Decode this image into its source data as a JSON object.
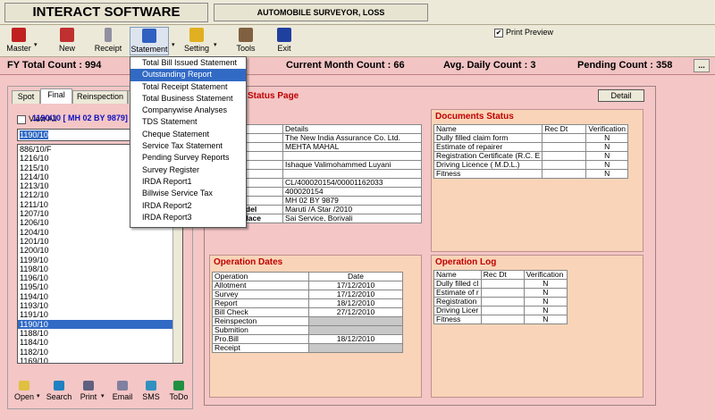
{
  "header": {
    "title": "INTERACT SOFTWARE",
    "subtitle": "AUTOMOBILE SURVEYOR, LOSS ASSESSOR_VALUERS"
  },
  "toolbar": {
    "master": "Master",
    "new": "New",
    "receipt": "Receipt",
    "statement": "Statement",
    "setting": "Setting",
    "tools": "Tools",
    "exit": "Exit",
    "print_preview": "Print Preview",
    "print_preview_checked": "✔"
  },
  "counts": {
    "fy_total": "FY Total Count : 994",
    "current_month": "Current Month Count : 66",
    "avg_daily": "Avg. Daily Count : 3",
    "pending": "Pending Count : 358",
    "more": "..."
  },
  "left": {
    "tabs": [
      "Spot",
      "Final",
      "Reinspection",
      "C"
    ],
    "view_all": "View All",
    "search_value": "1190/10",
    "ids": [
      "886/10/F",
      "1216/10",
      "1215/10",
      "1214/10",
      "1213/10",
      "1212/10",
      "1211/10",
      "1207/10",
      "1206/10",
      "1204/10",
      "1201/10",
      "1200/10",
      "1199/10",
      "1198/10",
      "1196/10",
      "1195/10",
      "1194/10",
      "1193/10",
      "1191/10",
      "1190/10",
      "1188/10",
      "1184/10",
      "1182/10",
      "1169/10"
    ],
    "selected_id": "1190/10"
  },
  "bottom": {
    "open": "Open",
    "search": "Search",
    "print": "Print",
    "email": "Email",
    "sms": "SMS",
    "todo": "ToDo"
  },
  "menu": {
    "items": [
      "Total Bill Issued Statement",
      "Outstanding Report",
      "Total Receipt Statement",
      "Total Business Statement",
      "Companywise Analyses",
      "TDS Statement",
      "Cheque Statement",
      "Service Tax Statement",
      "Pending Survey Reports",
      "Survey Register",
      "IRDA Report1",
      "Billwise Service Tax",
      "IRDA Report2",
      "IRDA Report3"
    ],
    "highlighted": "Outstanding Report"
  },
  "main": {
    "status_title": "Status Page",
    "detail_button": "Detail",
    "vehicle_id": "1190/10   [ MH 02 BY 9879]",
    "details_header": [
      "",
      "Details"
    ],
    "details": [
      {
        "label": "",
        "value": "The New India Assurance Co. Ltd."
      },
      {
        "label": "nch",
        "value": "MEHTA MAHAL"
      },
      {
        "label": "o.",
        "value": ""
      },
      {
        "label": "",
        "value": "Ishaque Valimohammed Luyani"
      },
      {
        "label": "o.",
        "value": ""
      },
      {
        "label": "o.",
        "value": "CL/400020154/00001162033"
      },
      {
        "label": "o.",
        "value": "400020154"
      },
      {
        "label": "o.",
        "value": "MH 02 BY 9879"
      },
      {
        "label": "Make/Model",
        "value": "Maruti /A Star /2010"
      },
      {
        "label": "Survey Place",
        "value": "Sai Service, Borivali"
      }
    ],
    "documents_title": "Documents Status",
    "documents_header": [
      "Name",
      "Rec Dt",
      "Verification"
    ],
    "documents": [
      {
        "name": "Dully filled claim form",
        "rec": "",
        "ver": "N"
      },
      {
        "name": "Estimate of repairer",
        "rec": "",
        "ver": "N"
      },
      {
        "name": "Registration Certificate (R.C. E",
        "rec": "",
        "ver": "N"
      },
      {
        "name": "Driving Licence ( M.D.L.)",
        "rec": "",
        "ver": "N"
      },
      {
        "name": "Fitness",
        "rec": "",
        "ver": "N"
      }
    ],
    "operation_dates_title": "Operation Dates",
    "operation_header": [
      "Operation",
      "Date"
    ],
    "operations": [
      {
        "op": "Allotment",
        "date": "17/12/2010"
      },
      {
        "op": "Survey",
        "date": "17/12/2010"
      },
      {
        "op": "Report",
        "date": "18/12/2010"
      },
      {
        "op": "Bill Check",
        "date": "27/12/2010"
      },
      {
        "op": "Reinspecton",
        "date": ""
      },
      {
        "op": "Submition",
        "date": ""
      },
      {
        "op": "Pro.Bill",
        "date": "18/12/2010"
      },
      {
        "op": "Receipt",
        "date": ""
      }
    ],
    "operation_log_title": "Operation Log",
    "log_header": [
      "Name",
      "Rec Dt",
      "Verification"
    ],
    "log": [
      {
        "name": "Dully filled cl",
        "rec": "",
        "ver": "N"
      },
      {
        "name": "Estimate of r",
        "rec": "",
        "ver": "N"
      },
      {
        "name": "Registration",
        "rec": "",
        "ver": "N"
      },
      {
        "name": "Driving Licer",
        "rec": "",
        "ver": "N"
      },
      {
        "name": "Fitness",
        "rec": "",
        "ver": "N"
      }
    ]
  }
}
